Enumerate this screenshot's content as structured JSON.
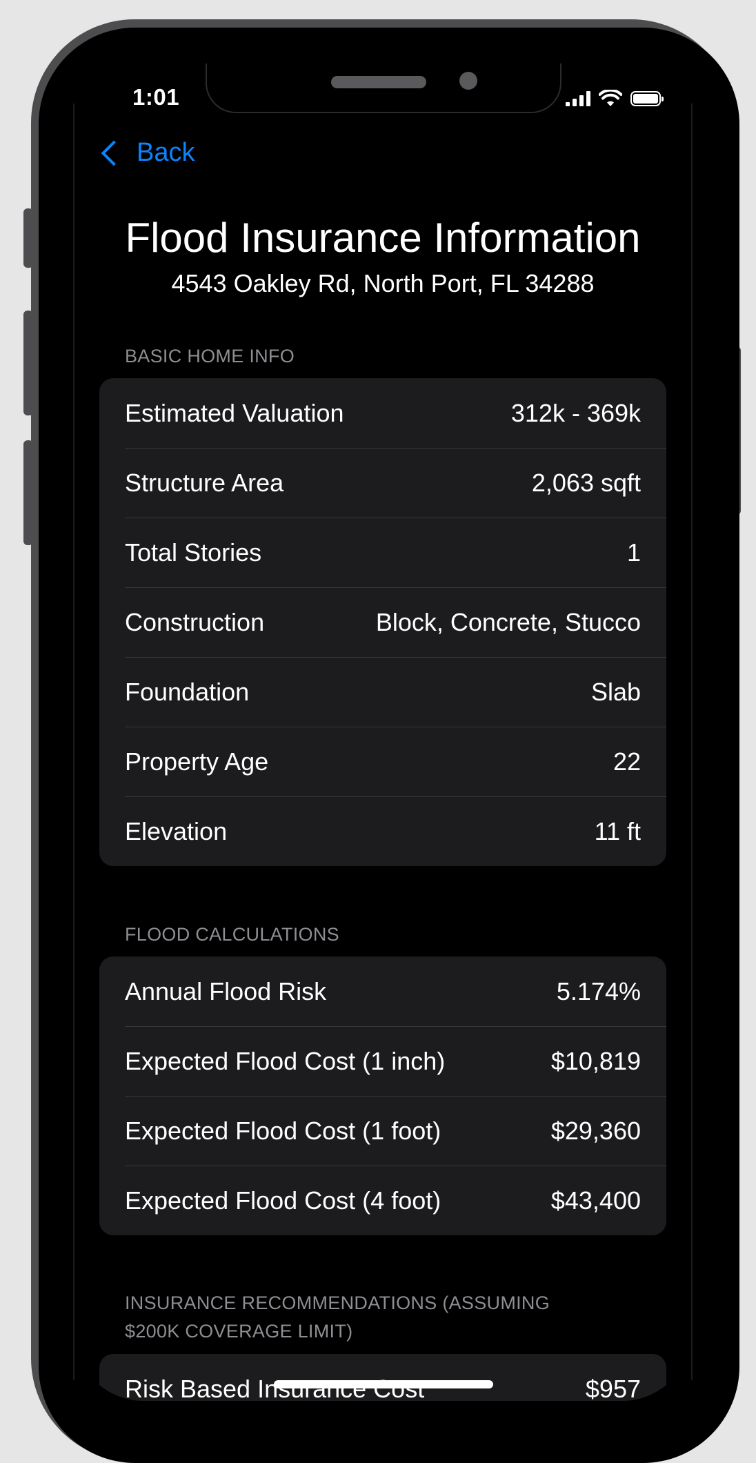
{
  "status_bar": {
    "time": "1:01"
  },
  "nav": {
    "back_label": "Back"
  },
  "header": {
    "title": "Flood Insurance Information",
    "address": "4543 Oakley Rd, North Port, FL 34288"
  },
  "sections": {
    "basic": {
      "label": "BASIC HOME INFO",
      "rows": [
        {
          "label": "Estimated Valuation",
          "value": "312k - 369k"
        },
        {
          "label": "Structure Area",
          "value": "2,063 sqft"
        },
        {
          "label": "Total Stories",
          "value": "1"
        },
        {
          "label": "Construction",
          "value": "Block, Concrete, Stucco"
        },
        {
          "label": "Foundation",
          "value": "Slab"
        },
        {
          "label": "Property Age",
          "value": "22"
        },
        {
          "label": "Elevation",
          "value": "11 ft"
        }
      ]
    },
    "flood": {
      "label": "FLOOD CALCULATIONS",
      "rows": [
        {
          "label": "Annual Flood Risk",
          "value": "5.174%"
        },
        {
          "label": "Expected Flood Cost (1 inch)",
          "value": "$10,819"
        },
        {
          "label": "Expected Flood Cost (1 foot)",
          "value": "$29,360"
        },
        {
          "label": "Expected Flood Cost (4 foot)",
          "value": "$43,400"
        }
      ]
    },
    "insurance": {
      "label_line1": "INSURANCE RECOMMENDATIONS (ASSUMING",
      "label_line2": "$200K COVERAGE LIMIT)",
      "rows": [
        {
          "label": "Risk Based Insurance Cost",
          "value": "$957"
        }
      ]
    }
  }
}
